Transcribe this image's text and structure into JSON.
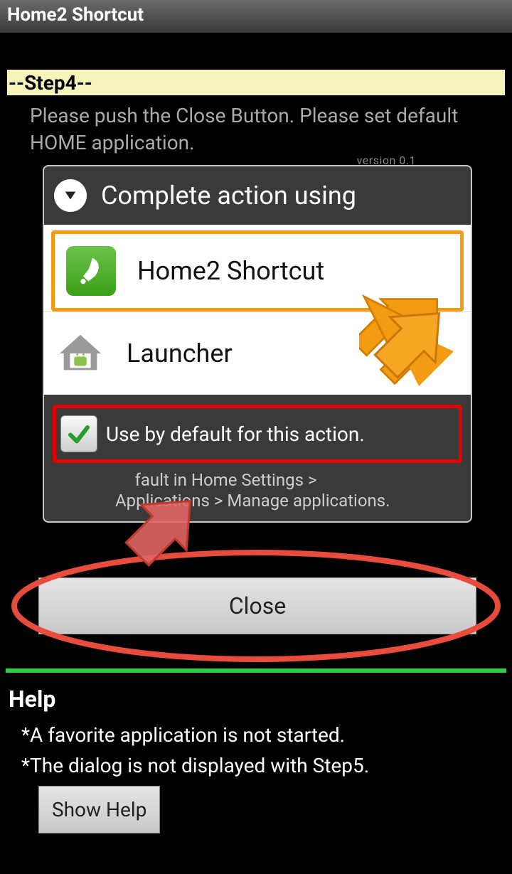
{
  "titlebar": "Home2 Shortcut",
  "step": {
    "banner": "--Step4--",
    "instruction": "Please push the Close Button. Please set default HOME application."
  },
  "bg_version": "version 0.1",
  "dialog": {
    "title": "Complete action using",
    "options": [
      {
        "label": "Home2 Shortcut"
      },
      {
        "label": "Launcher"
      }
    ],
    "default_label": "Use by default for this action.",
    "hint_line1": "fault in Home Settings >",
    "hint_line2": "Applications > Manage applications."
  },
  "close_button": "Close",
  "help": {
    "title": "Help",
    "line1": "*A favorite application is not started.",
    "line2": "*The dialog is not displayed with Step5.",
    "show_button": "Show Help"
  }
}
